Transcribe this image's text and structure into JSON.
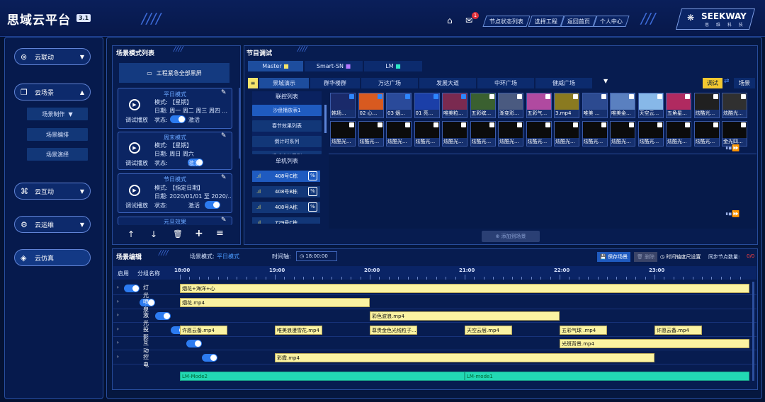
{
  "header": {
    "logo": "思域云平台",
    "version": "3.1",
    "nav": [
      "节点状态列表",
      "选择工程",
      "返回首页",
      "个人中心"
    ],
    "mail_count": "1",
    "brand_name": "SEEKWAY",
    "brand_sub": "思 维 科 技"
  },
  "sidebar": {
    "items": [
      {
        "label": "云联动",
        "icon": "link-icon"
      },
      {
        "label": "云场景",
        "icon": "scene-icon"
      },
      {
        "label": "云互动",
        "icon": "interact-icon"
      },
      {
        "label": "云运维",
        "icon": "maintenance-icon"
      },
      {
        "label": "云仿真",
        "icon": "simulation-icon"
      }
    ],
    "sub": [
      "场景制作",
      "场景编排",
      "场景演绎"
    ]
  },
  "scene_list": {
    "title": "场景模式列表",
    "emergency": "工程紧急全部黑屏",
    "cards": [
      {
        "title": "平日模式",
        "mode": "模式: 【星期】",
        "date": "日期: 周一 周二 周三 周四 ...",
        "play": "调试播放",
        "status": "状态:",
        "status_val": "激活"
      },
      {
        "title": "周末模式",
        "mode": "模式: 【星期】",
        "date": "日期: 周日 周六",
        "play": "调试播放",
        "status": "状态:",
        "status_val": "激活"
      },
      {
        "title": "节日模式",
        "mode": "模式: 【指定日期】",
        "date": "日期: 2020/01/01 至 2020/...",
        "play": "调试播放",
        "status": "状态:",
        "status_val": "激活"
      },
      {
        "title": "元旦效果"
      }
    ]
  },
  "program": {
    "title": "节目调试",
    "tabs": [
      "Master",
      "Smart-SN",
      "LM"
    ],
    "areas": [
      "景城演示",
      "群华楼群",
      "万达广场",
      "发展大道",
      "中环广场",
      "健威广场"
    ],
    "debug_btn": "调试",
    "scene_btn": "场景",
    "link_list_title": "联控列表",
    "link_list": [
      "沙盘播放表1",
      "春节效果列表",
      "倒计时系列",
      "换戏光效系列"
    ],
    "device_title": "单机列表",
    "devices": [
      "408号C栋",
      "408号B栋",
      "408号A栋",
      "729号C栋"
    ],
    "add_btn": "添加到场景",
    "thumbs_row1": [
      "韩场...",
      "02 心...",
      "03 烟...",
      "01 亮...",
      "唯美粒...",
      "五彩缤...",
      "渐变彩...",
      "五彩气...",
      "3.mp4",
      "唯美 ...",
      "唯美金...",
      "天空云...",
      "五角星...",
      "炫酷光...",
      "炫酷光..."
    ],
    "thumbs_row2": [
      "炫酷光...",
      "炫酷光...",
      "炫酷光...",
      "炫酷光...",
      "炫酷光...",
      "炫酷光...",
      "炫酷光...",
      "炫酷光...",
      "炫酷光...",
      "炫酷光...",
      "炫酷光...",
      "炫酷光...",
      "炫酷光...",
      "炫酷光...",
      "金光四..."
    ]
  },
  "editor": {
    "title": "场景编辑",
    "mode_label": "场景模式:",
    "mode_val": "平日模式",
    "time_label": "时间轴:",
    "time_val": "18:00:00",
    "save": "保存场景",
    "delete": "删除",
    "timeline_btn": "时间轴度尺设置",
    "sync_label": "同步节点数量:",
    "sync_val": "0/0",
    "col_enable": "启用",
    "col_name": "分组名称",
    "hours": [
      "18:00",
      "19:00",
      "20:00",
      "21:00",
      "22:00",
      "23:00"
    ],
    "tracks": [
      "灯光",
      "喷泉",
      "激光",
      "投影",
      "互动",
      "控电"
    ],
    "bars": [
      {
        "track": 0,
        "label": "烟花+海洋+心",
        "start": 0,
        "end": 6
      },
      {
        "track": 1,
        "label": "烟花.mp4",
        "start": 0,
        "end": 2
      },
      {
        "track": 2,
        "label": "彩色波浪.mp4",
        "start": 2,
        "end": 4
      },
      {
        "track": 3,
        "label": "许愿云备.mp4",
        "start": 0,
        "end": 0.5
      },
      {
        "track": 3,
        "label": "唯美浪漫雪花.mp4",
        "start": 1,
        "end": 1.5
      },
      {
        "track": 3,
        "label": "尊贵金色光线粒子...",
        "start": 2,
        "end": 2.5
      },
      {
        "track": 3,
        "label": "天空云层.mp4",
        "start": 3,
        "end": 3.5
      },
      {
        "track": 3,
        "label": "五彩气球 .mp4",
        "start": 4,
        "end": 4.5
      },
      {
        "track": 3,
        "label": "许愿云备.mp4",
        "start": 5,
        "end": 5.5
      },
      {
        "track": 4,
        "label": "光斑背景.mp4",
        "start": 4,
        "end": 6
      },
      {
        "track": 5,
        "label": "彩霞.mp4",
        "start": 1,
        "end": 5
      }
    ],
    "lm_bars": [
      {
        "label": "LM-Mode2",
        "start": 0,
        "end": 3
      },
      {
        "label": "LM-mode1",
        "start": 3,
        "end": 6
      }
    ]
  }
}
